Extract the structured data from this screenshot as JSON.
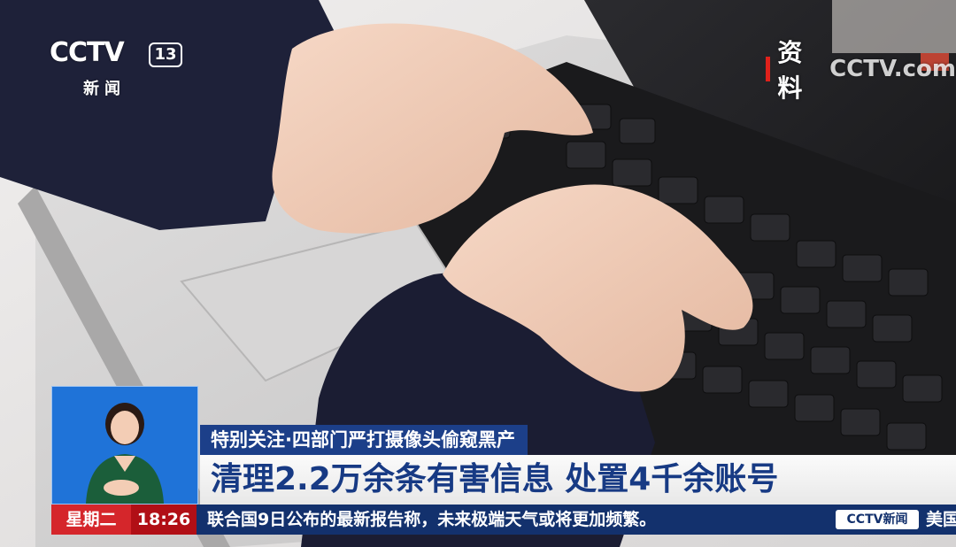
{
  "channel": {
    "brand": "CCTV",
    "number": "13",
    "subtitle": "新闻"
  },
  "material_tag": {
    "label": "资料",
    "watermark": "CCTV.com"
  },
  "lower_third": {
    "topic": "特别关注·四部门严打摄像头偷窥黑产",
    "headline": "清理2.2万余条有害信息 处置4千余账号"
  },
  "ticker": {
    "weekday": "星期二",
    "time": "18:26",
    "text": "联合国9日公布的最新报告称，未来极端天气或将更加频繁。",
    "logo": "CCTV新闻",
    "tail": "美国"
  },
  "colors": {
    "accent_red": "#d5262b",
    "navy": "#13316d",
    "headline_blue": "#173a84",
    "sign_blue": "#1f73d8"
  }
}
